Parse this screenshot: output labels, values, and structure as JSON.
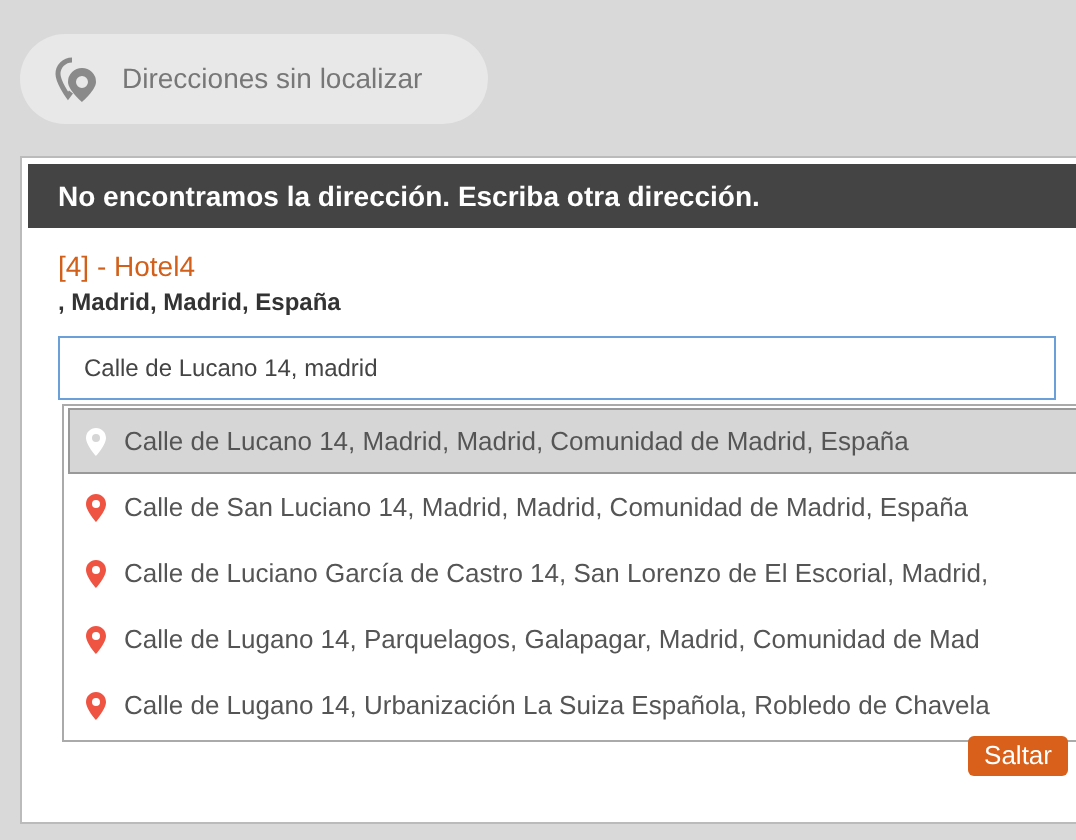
{
  "locate_button": {
    "label": "Direcciones sin localizar"
  },
  "dialog": {
    "header": "No encontramos la dirección. Escriba otra dirección.",
    "record_title": "[4] - Hotel4",
    "record_address": ", Madrid, Madrid, España",
    "address_field": {
      "value": "Calle de Lucano 14, madrid"
    },
    "suggestions": [
      {
        "label": "Calle de Lucano 14, Madrid, Madrid, Comunidad de Madrid, España",
        "selected": true
      },
      {
        "label": "Calle de San Luciano 14, Madrid, Madrid, Comunidad de Madrid, España",
        "selected": false
      },
      {
        "label": "Calle de Luciano García de Castro 14, San Lorenzo de El Escorial, Madrid,",
        "selected": false
      },
      {
        "label": "Calle de Lugano 14, Parquelagos, Galapagar, Madrid, Comunidad de Mad",
        "selected": false
      },
      {
        "label": "Calle de Lugano 14, Urbanización La Suiza Española, Robledo de Chavela",
        "selected": false
      }
    ],
    "skip_button": "Saltar"
  }
}
